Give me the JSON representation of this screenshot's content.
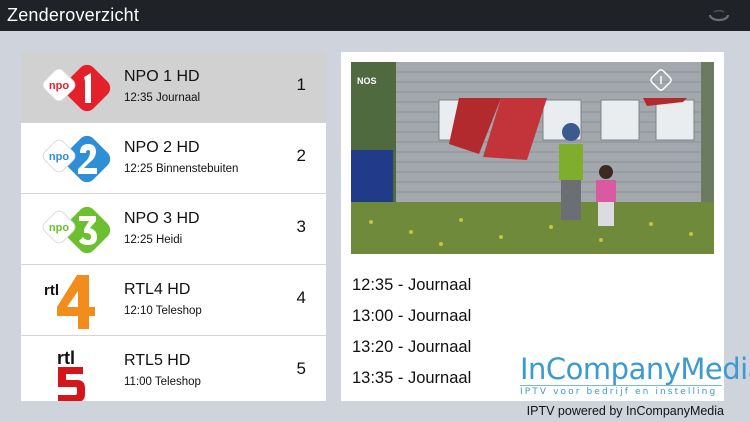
{
  "header": {
    "title": "Zenderoverzicht",
    "loader_icon": "activity-spinner-icon"
  },
  "channels": [
    {
      "name": "NPO 1 HD",
      "program": "12:35 Journaal",
      "number": "1",
      "logo": "npo-1-logo",
      "logo_text": "npo",
      "selected": true
    },
    {
      "name": "NPO 2 HD",
      "program": "12:25 Binnenstebuiten",
      "number": "2",
      "logo": "npo-2-logo",
      "logo_text": "npo"
    },
    {
      "name": "NPO 3 HD",
      "program": "12:25 Heidi",
      "number": "3",
      "logo": "npo-3-logo",
      "logo_text": "npo"
    },
    {
      "name": "RTL4 HD",
      "program": "12:10 Teleshop",
      "number": "4",
      "logo": "rtl-4-logo",
      "logo_text": "rtl"
    },
    {
      "name": "RTL5 HD",
      "program": "11:00 Teleshop",
      "number": "5",
      "logo": "rtl-5-logo",
      "logo_text": "rtl"
    }
  ],
  "preview": {
    "watermark_left": "NOS",
    "schedule": [
      "12:35 - Journaal",
      "13:00 - Journaal",
      "13:20 - Journaal",
      "13:35 - Journaal"
    ]
  },
  "brand": {
    "name": "InCompanyMedia",
    "tagline": "IPTV voor bedrijf en instelling"
  },
  "footer": {
    "powered_by": "IPTV powered by InCompanyMedia"
  },
  "colors": {
    "background": "#cfd3dc",
    "topbar": "#1f2227",
    "selected_row": "#d1d1d1",
    "npo1": "#e4202a",
    "npo2": "#2d8fd6",
    "npo3": "#6cbf2e",
    "rtl4": "#f28c1c",
    "rtl5": "#d4161b",
    "brand": "#3b9bd1"
  }
}
